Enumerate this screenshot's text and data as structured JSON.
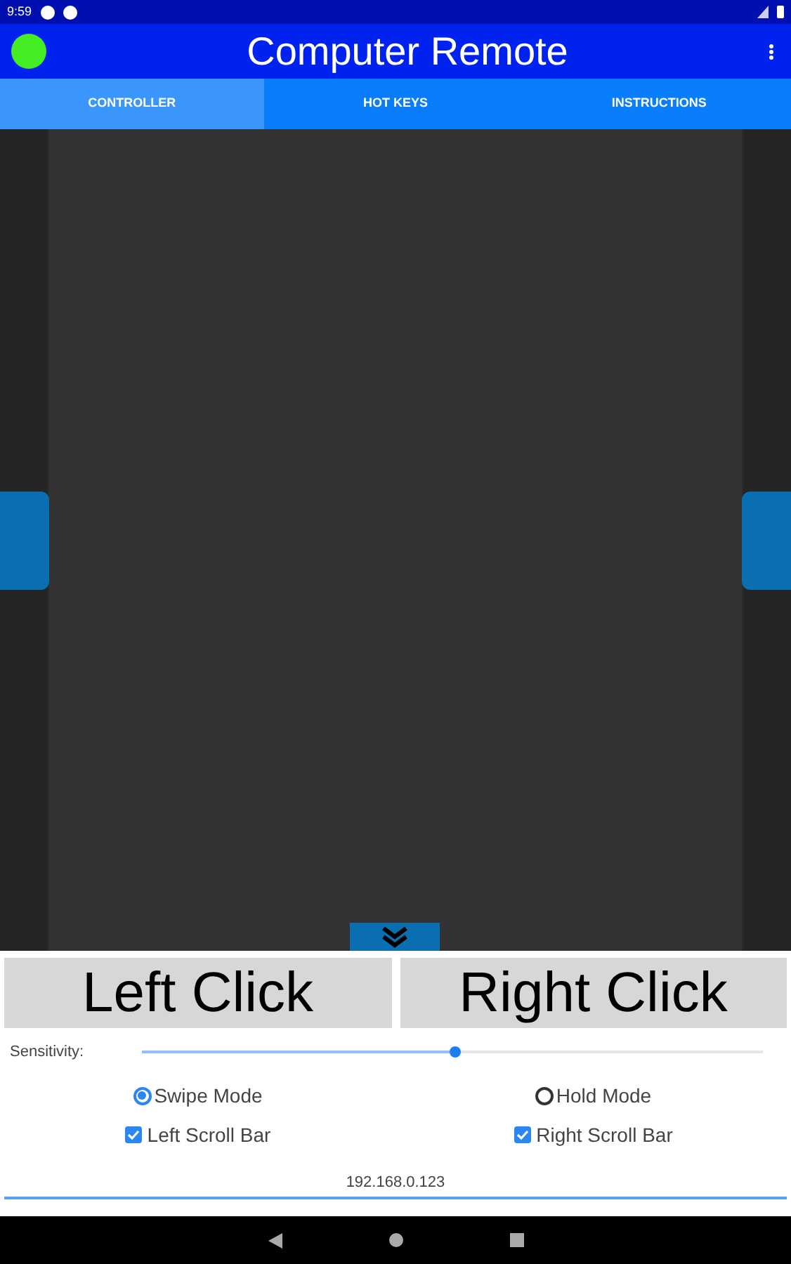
{
  "status_bar": {
    "time": "9:59"
  },
  "app_bar": {
    "title": "Computer Remote"
  },
  "tabs": [
    {
      "label": "CONTROLLER",
      "selected": true
    },
    {
      "label": "HOT KEYS",
      "selected": false
    },
    {
      "label": "INSTRUCTIONS",
      "selected": false
    }
  ],
  "click_buttons": [
    "Left Click",
    "Right Click"
  ],
  "sensitivity": {
    "label": "Sensitivity:",
    "level": 0.505
  },
  "modes": [
    {
      "label": "Swipe Mode",
      "selected": true
    },
    {
      "label": "Hold Mode",
      "selected": false
    }
  ],
  "scroll_bars": [
    {
      "label": "Left Scroll Bar",
      "checked": true
    },
    {
      "label": "Right Scroll Bar",
      "checked": true
    }
  ],
  "address": {
    "value": "192.168.0.123"
  }
}
